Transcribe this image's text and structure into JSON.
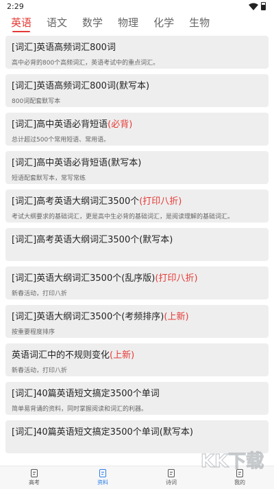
{
  "status": {
    "time": "2:29"
  },
  "colors": {
    "accent": "#e53935",
    "nav_active": "#2b7de9",
    "card_bg": "#eeeeee"
  },
  "tabs": [
    {
      "label": "英语",
      "active": true
    },
    {
      "label": "语文"
    },
    {
      "label": "数学"
    },
    {
      "label": "物理"
    },
    {
      "label": "化学"
    },
    {
      "label": "生物"
    }
  ],
  "items": [
    {
      "title": "[词汇]英语高频词汇800词",
      "tag": "",
      "desc": "高中必背的800个高频词汇，英语考试中的重点词汇。"
    },
    {
      "title": "[词汇]英语高频词汇800词(默写本)",
      "tag": "",
      "desc": "800词配套默写本"
    },
    {
      "title": "[词汇]高中英语必背短语",
      "tag": "(必背)",
      "desc": "总计超过500个常用短语、常用语。"
    },
    {
      "title": "[词汇]高中英语必背短语(默写本)",
      "tag": "",
      "desc": "短语配套默写本，常写常练"
    },
    {
      "title": "[词汇]高考英语大纲词汇3500个",
      "tag": "(打印八折)",
      "desc": "考试大纲要求的基础词汇，更是高中生必背的基础词汇，是阅读理解的基础词汇。"
    },
    {
      "title": "[词汇]高考英语大纲词汇3500个(默写本)",
      "tag": "",
      "desc": ""
    },
    {
      "title": "[词汇]英语大纲词汇3500个(乱序版)",
      "tag": "(打印八折)",
      "desc": "新春活动，打印八折"
    },
    {
      "title": "[词汇]英语大纲词汇3500个(考频排序)",
      "tag": "(上新)",
      "desc": "按重要程度排序"
    },
    {
      "title": "英语词汇中的不规则变化",
      "tag": "(上新)",
      "desc": "新春活动，打印八折"
    },
    {
      "title": "[词汇]40篇英语短文搞定3500个单词",
      "tag": "",
      "desc": "简单易背诵的资料，同时掌握阅读和词汇的利器。"
    },
    {
      "title": "[词汇]40篇英语短文搞定3500个单词(默写本)",
      "tag": "",
      "desc": ""
    }
  ],
  "nav": [
    {
      "label": "高考",
      "icon": "exam-icon"
    },
    {
      "label": "资料",
      "icon": "document-icon",
      "active": true
    },
    {
      "label": "诗词",
      "icon": "poetry-icon"
    },
    {
      "label": "我的",
      "icon": "profile-icon"
    }
  ],
  "watermark": {
    "text": "KK下载"
  }
}
